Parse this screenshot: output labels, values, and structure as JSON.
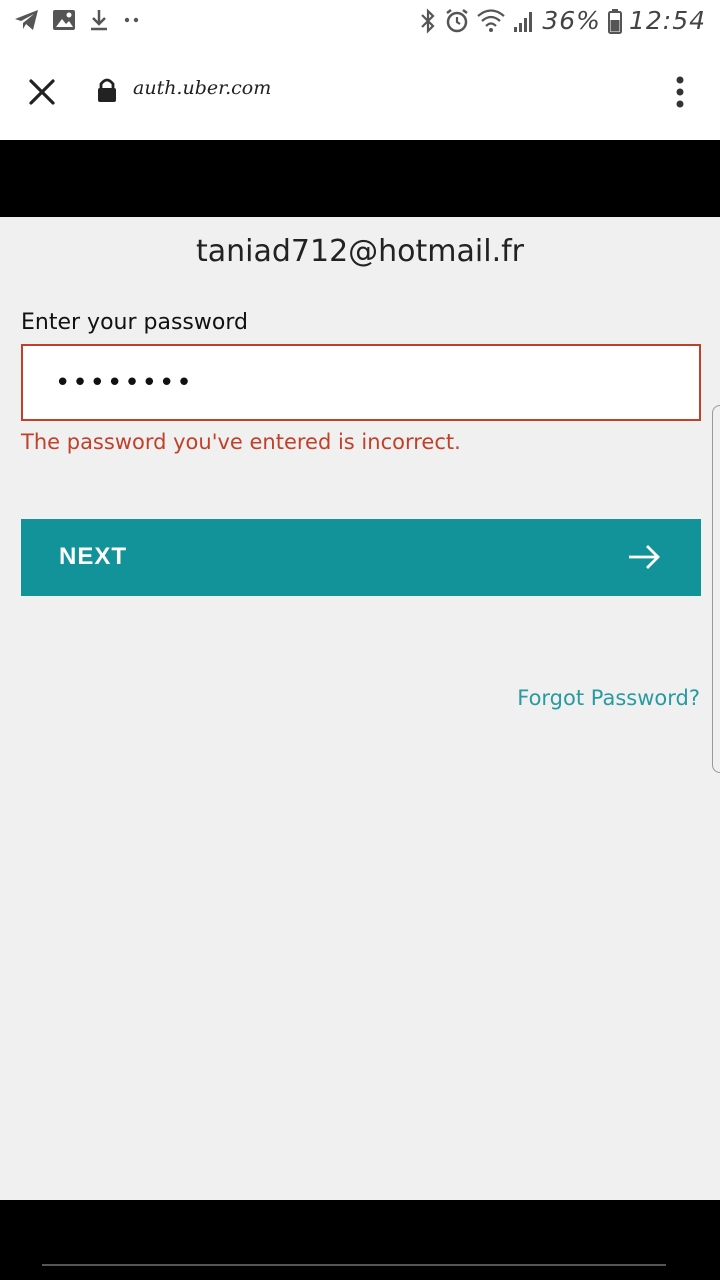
{
  "status_bar": {
    "battery": "36%",
    "time": "12:54",
    "icons": [
      "telegram-icon",
      "image-icon",
      "download-icon",
      "more-dots-icon",
      "bluetooth-icon",
      "alarm-icon",
      "wifi-icon",
      "signal-icon",
      "battery-icon"
    ]
  },
  "browser": {
    "url": "auth.uber.com",
    "icons": [
      "close-icon",
      "lock-icon",
      "kebab-menu-icon"
    ]
  },
  "login": {
    "email": "taniad712@hotmail.fr",
    "password_label": "Enter your password",
    "password_value": "••••••••",
    "error": "The password you've entered is incorrect.",
    "next_label": "NEXT",
    "forgot_label": "Forgot Password?"
  },
  "colors": {
    "accent": "#12939a",
    "error": "#c0412a",
    "link": "#2a9aa0",
    "background": "#f0f0f0"
  }
}
